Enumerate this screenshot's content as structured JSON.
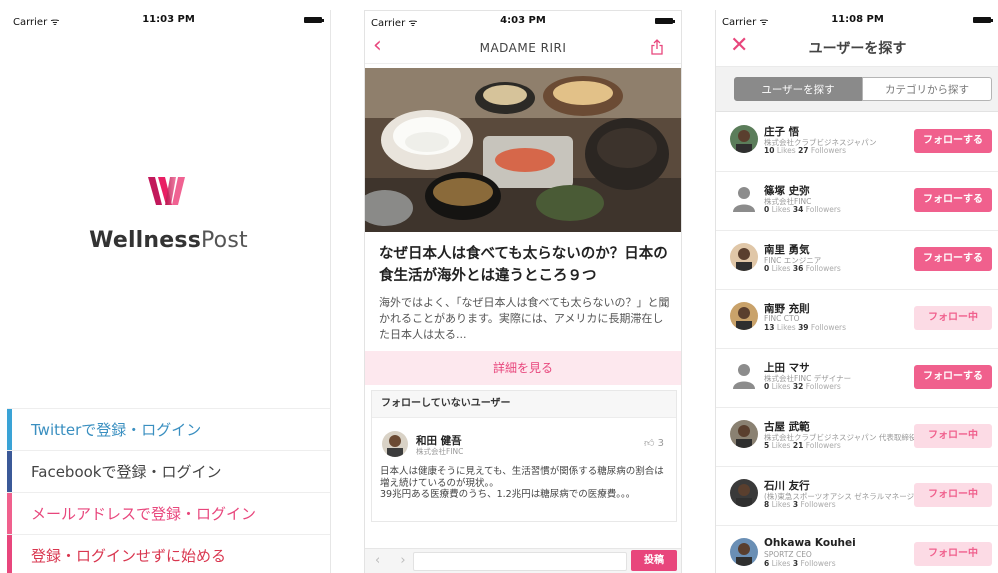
{
  "screen1": {
    "status": {
      "carrier": "Carrier ᯤ",
      "time": "11:03 PM"
    },
    "logo": {
      "bold": "Wellness",
      "thin": "Post"
    },
    "login_options": [
      {
        "label": "Twitterで登録・ログイン",
        "color": "#3aa3d6",
        "text_color": "#3a8fc0"
      },
      {
        "label": "Facebookで登録・ログイン",
        "color": "#3b5998",
        "text_color": "#444444"
      },
      {
        "label": "メールアドレスで登録・ログイン",
        "color": "#f0608d",
        "text_color": "#e8467c"
      },
      {
        "label": "登録・ログインせずに始める",
        "color": "#e8467c",
        "text_color": "#d9364f"
      }
    ]
  },
  "screen2": {
    "status": {
      "carrier": "Carrier ᯤ",
      "time": "4:03 PM"
    },
    "nav": {
      "back_icon": "chevron-left-icon",
      "title": "MADAME RIRI",
      "share_icon": "share-icon"
    },
    "article": {
      "title": "なぜ日本人は食べても太らないのか？日本の食生活が海外とは違うところ９つ",
      "body": "海外ではよく、「なぜ日本人は食べても太らないの？」と聞かれることがあります。実際には、アメリカに長期滞在した日本人は太る...",
      "more_label": "詳細を見る"
    },
    "unfollowed": {
      "header": "フォローしていないユーザー",
      "user_name": "和田 健吾",
      "company": "株式会社FINC",
      "likes": "3",
      "text": "日本人は健康そうに見えても、生活習慣が関係する糖尿病の割合は増え続けているのが現状。。\n39兆円ある医療費のうち、1.2兆円は糖尿病での医療費。。。"
    },
    "bottom": {
      "prev_next": "‹ ›",
      "post_label": "投稿"
    }
  },
  "screen3": {
    "status": {
      "carrier": "Carrier ᯤ",
      "time": "11:08 PM"
    },
    "nav": {
      "close_icon": "close-icon",
      "title": "ユーザーを探す"
    },
    "segments": [
      "ユーザーを探す",
      "カテゴリから探す"
    ],
    "users": [
      {
        "name": "庄子 悟",
        "company": "株式会社クラブビジネスジャパン",
        "likes": "10",
        "followers": "27",
        "action": "フォローする",
        "following": false
      },
      {
        "name": "篠塚 史弥",
        "company": "株式会社FINC",
        "likes": "0",
        "followers": "34",
        "action": "フォローする",
        "following": false
      },
      {
        "name": "南里 勇気",
        "company": "FINC エンジニア",
        "likes": "0",
        "followers": "36",
        "action": "フォローする",
        "following": false
      },
      {
        "name": "南野 充則",
        "company": "FINC CTO",
        "likes": "13",
        "followers": "39",
        "action": "フォロー中",
        "following": true
      },
      {
        "name": "上田 マサ",
        "company": "株式会社FINC デザイナー",
        "likes": "0",
        "followers": "32",
        "action": "フォローする",
        "following": false
      },
      {
        "name": "古屋 武範",
        "company": "株式会社クラブビジネスジャパン 代表取締役社長",
        "likes": "5",
        "followers": "21",
        "action": "フォロー中",
        "following": true
      },
      {
        "name": "石川 友行",
        "company": "(株)東急スポーツオアシス ゼネラルマネージャー",
        "likes": "8",
        "followers": "3",
        "action": "フォロー中",
        "following": true
      },
      {
        "name": "Ohkawa Kouhei",
        "company": "SPORTZ CEO",
        "likes": "6",
        "followers": "3",
        "action": "フォロー中",
        "following": true
      }
    ],
    "likes_label": "Likes",
    "followers_label": "Followers"
  }
}
